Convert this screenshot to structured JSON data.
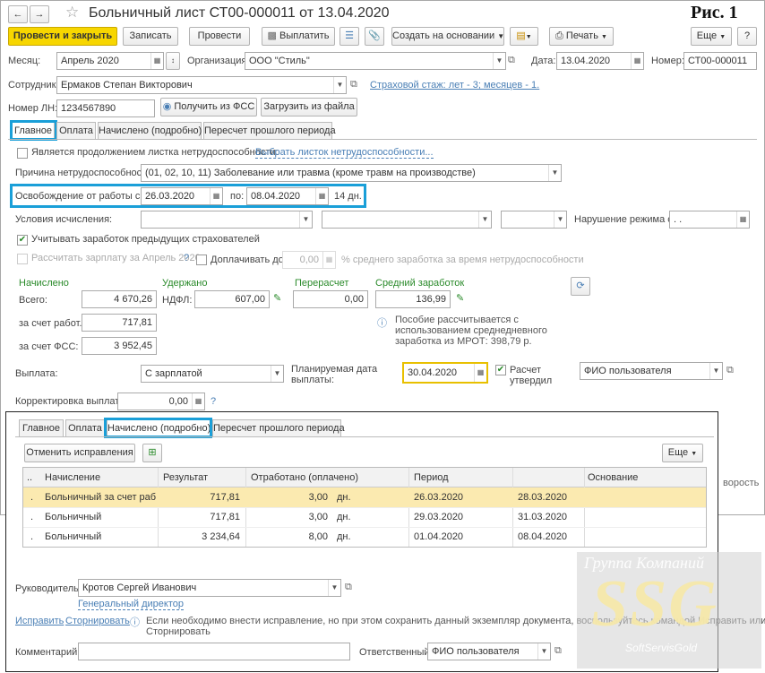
{
  "figure_label": "Рис. 1",
  "title": "Больничный лист СТ00-000011 от 13.04.2020",
  "toolbar": {
    "post_close": "Провести и закрыть",
    "save": "Записать",
    "post": "Провести",
    "pay": "Выплатить",
    "create_based": "Создать на основании",
    "print": "Печать",
    "more": "Еще",
    "help": "?"
  },
  "header": {
    "month_label": "Месяц:",
    "month": "Апрель 2020",
    "org_label": "Организация:",
    "org": "ООО \"Стиль\"",
    "date_label": "Дата:",
    "date": "13.04.2020",
    "number_label": "Номер:",
    "number": "СТ00-000011",
    "employee_label": "Сотрудник:",
    "employee": "Ермаков Степан Викторович",
    "insurance_link": "Страховой стаж: лет - 3; месяцев - 1.",
    "ln_label": "Номер ЛН:",
    "ln": "1234567890",
    "get_fss": "Получить из ФСС",
    "load_file": "Загрузить из файла"
  },
  "tabs": [
    "Главное",
    "Оплата",
    "Начислено (подробно)",
    "Пересчет прошлого периода"
  ],
  "main": {
    "continuation": "Является продолжением листка нетрудоспособности:",
    "choose_sheet": "Выбрать листок нетрудоспособности...",
    "reason_label": "Причина нетрудоспособности:",
    "reason": "(01, 02, 10, 11) Заболевание или травма (кроме травм на производстве)",
    "release_label": "Освобождение от работы с:",
    "release_from": "26.03.2020",
    "release_to_label": "по:",
    "release_to": "08.04.2020",
    "days": "14 дн.",
    "conditions_label": "Условия исчисления:",
    "violation_label": "Нарушение режима с:",
    "violation_date": " .  .",
    "consider_prev": "Учитывать заработок предыдущих страхователей",
    "calc_salary": "Рассчитать зарплату за Апрель 2020",
    "question": "?",
    "topup_label": "Доплачивать до",
    "topup": "0,00",
    "topup_note": "% среднего заработка за время нетрудоспособности"
  },
  "accrual": {
    "charged": "Начислено",
    "withheld": "Удержано",
    "recalc": "Перерасчет",
    "avg": "Средний заработок",
    "total_label": "Всего:",
    "total": "4 670,26",
    "ndfl_label": "НДФЛ:",
    "ndfl": "607,00",
    "recalc_val": "0,00",
    "avg_val": "136,99",
    "employer_label": "за счет работ.:",
    "employer": "717,81",
    "fss_label": "за счет ФСС:",
    "fss": "3 952,45",
    "mrot_note_1": "Пособие рассчитывается с",
    "mrot_note_2": "использованием среднедневного",
    "mrot_note_3": "заработка из МРОТ: 398,79 р."
  },
  "payment": {
    "label": "Выплата:",
    "value": "С зарплатой",
    "planned_label_1": "Планируемая дата",
    "planned_label_2": "выплаты:",
    "planned": "30.04.2020",
    "approved_1": "Расчет",
    "approved_2": "утвердил",
    "user": "ФИО пользователя",
    "correction_label": "Корректировка выплаты:",
    "correction": "0,00",
    "question": "?"
  },
  "bg_right": "ворость",
  "inset": {
    "tabs": [
      "Главное",
      "Оплата",
      "Начислено (подробно)",
      "Пересчет прошлого периода"
    ],
    "cancel_fix": "Отменить исправления",
    "more": "Еще",
    "columns": [
      "..",
      "Начисление",
      "Результат",
      "Отработано (оплачено)",
      "Период",
      "",
      "Основание"
    ],
    "rows": [
      {
        "n": ".",
        "name": "Больничный за счет раб...",
        "result": "717,81",
        "worked": "3,00",
        "unit": "дн.",
        "from": "26.03.2020",
        "to": "28.03.2020"
      },
      {
        "n": ".",
        "name": "Больничный",
        "result": "717,81",
        "worked": "3,00",
        "unit": "дн.",
        "from": "29.03.2020",
        "to": "31.03.2020"
      },
      {
        "n": ".",
        "name": "Больничный",
        "result": "3 234,64",
        "worked": "8,00",
        "unit": "дн.",
        "from": "01.04.2020",
        "to": "08.04.2020"
      }
    ]
  },
  "footer": {
    "head_label": "Руководитель:",
    "head": "Кротов Сергей Иванович",
    "position": "Генеральный директор",
    "fix": "Исправить",
    "reverse": "Сторнировать",
    "note_1": "Если необходимо внести исправление, но при этом сохранить данный экземпляр документа, воспользуйтесь командой Исправить или",
    "note_2": "Сторнировать",
    "comment_label": "Комментарий:",
    "responsible_label": "Ответственный:",
    "responsible": "ФИО пользователя"
  },
  "watermark": {
    "group": "Группа Компаний",
    "logo": "SSG",
    "brand": "SoftServisGold"
  }
}
